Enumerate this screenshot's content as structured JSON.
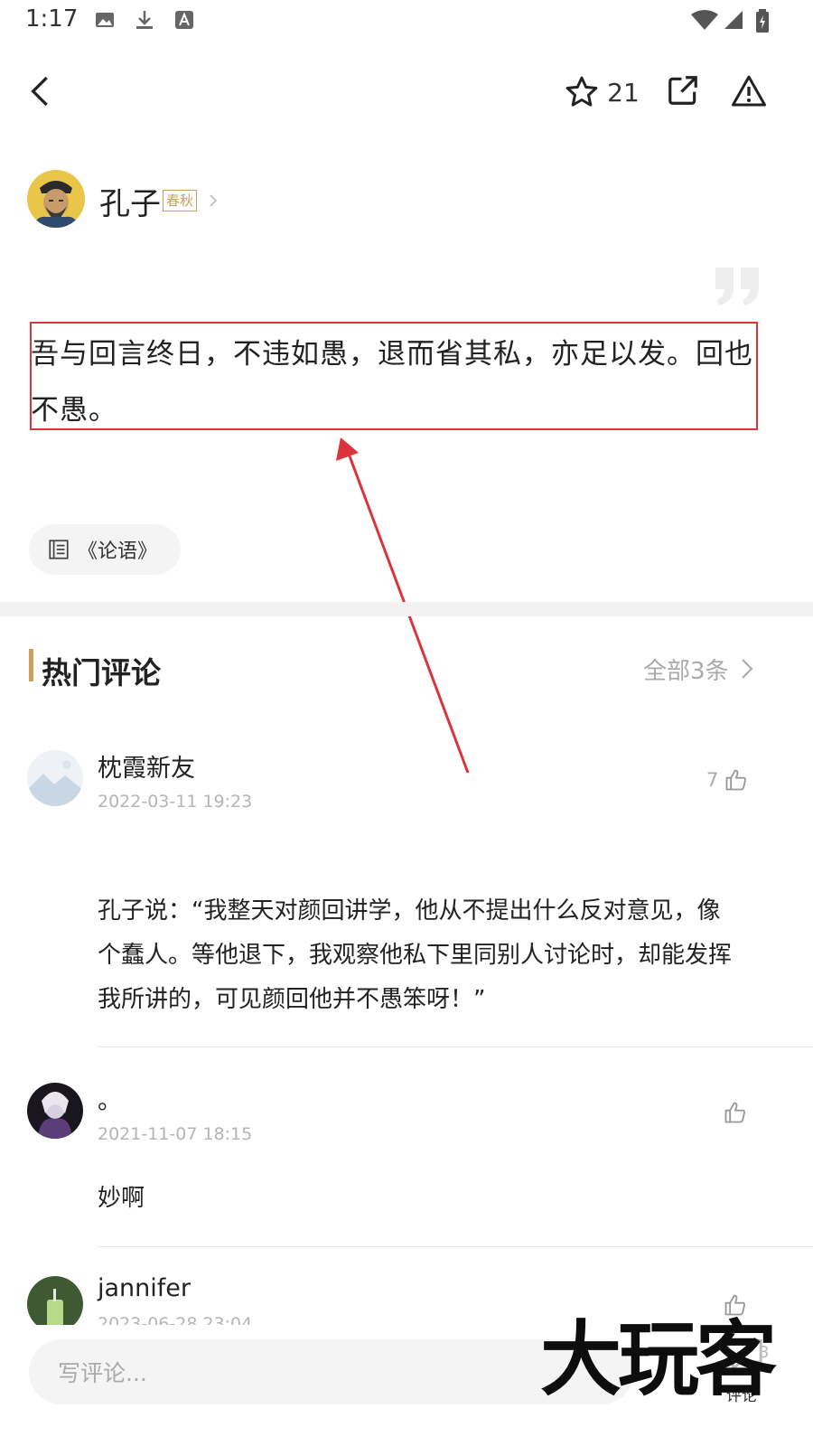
{
  "status_bar": {
    "time": "1:17"
  },
  "header": {
    "favorite_count": "21"
  },
  "author": {
    "name": "孔子",
    "dynasty": "春秋"
  },
  "quote": {
    "line1": "吾与回言终日，不违如愚，退而省其私，亦足以发。回也",
    "line2": "不愚。"
  },
  "source": {
    "title": "《论语》"
  },
  "comments_section": {
    "title": "热门评论",
    "see_all": "全部3条"
  },
  "comments": [
    {
      "name": "枕霞新友",
      "time": "2022-03-11 19:23",
      "likes": "7",
      "text": [
        "孔子说：“我整天对颜回讲学，他从不提出什么反对意见，像",
        "个蠢人。等他退下，我观察他私下里同别人讨论时，却能发挥",
        "我所讲的，可见颜回他并不愚笨呀！”"
      ]
    },
    {
      "name": "。",
      "time": "2021-11-07 18:15",
      "likes": "",
      "text": [
        "妙啊"
      ]
    },
    {
      "name": "jannifer",
      "time": "2023-06-28 23:04",
      "likes": ""
    }
  ],
  "bottom_bar": {
    "input_placeholder": "写评论...",
    "comment_label": "评论",
    "comment_count": "3"
  },
  "watermark": {
    "text": "大玩客"
  },
  "annotation": {
    "color": "#d9353b"
  },
  "colors": {
    "accent_gold": "#c8a25a"
  }
}
